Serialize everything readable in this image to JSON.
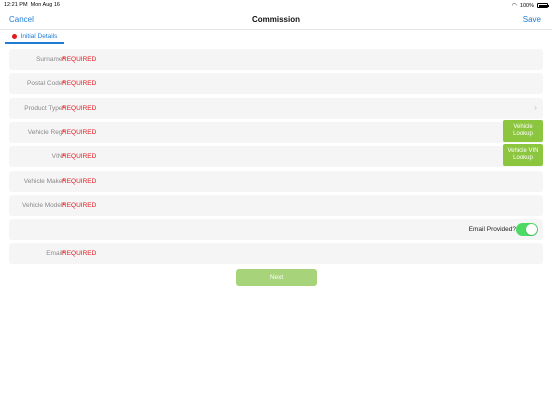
{
  "status_bar": {
    "time": "12:21 PM",
    "date": "Mon Aug 16",
    "battery": "100%"
  },
  "nav": {
    "cancel": "Cancel",
    "title": "Commission",
    "save": "Save"
  },
  "tab": {
    "label": "Initial Details"
  },
  "fields": [
    {
      "label": "Surname",
      "required_star": "*",
      "placeholder": "REQUIRED"
    },
    {
      "label": "Postal Code",
      "required_star": "*",
      "placeholder": "REQUIRED"
    },
    {
      "label": "Product Type",
      "required_star": "*",
      "placeholder": "REQUIRED"
    },
    {
      "label": "Vehicle Reg",
      "required_star": "*",
      "placeholder": "REQUIRED",
      "button": "Vehicle Lookup"
    },
    {
      "label": "VIN",
      "required_star": "*",
      "placeholder": "REQUIRED",
      "button": "Vehicle VIN Lookup"
    },
    {
      "label": "Vehicle Make",
      "required_star": "*",
      "placeholder": "REQUIRED"
    },
    {
      "label": "Vehicle Model",
      "required_star": "*",
      "placeholder": "REQUIRED"
    },
    {
      "label": "Email",
      "required_star": "*",
      "placeholder": "REQUIRED"
    }
  ],
  "email_provided": {
    "label": "Email Provided?",
    "on": true
  },
  "next_label": "Next",
  "colors": {
    "accent": "#1e7cd6",
    "required": "#e0191f",
    "button_green": "#8cc63f",
    "toggle_on": "#4cd964"
  }
}
